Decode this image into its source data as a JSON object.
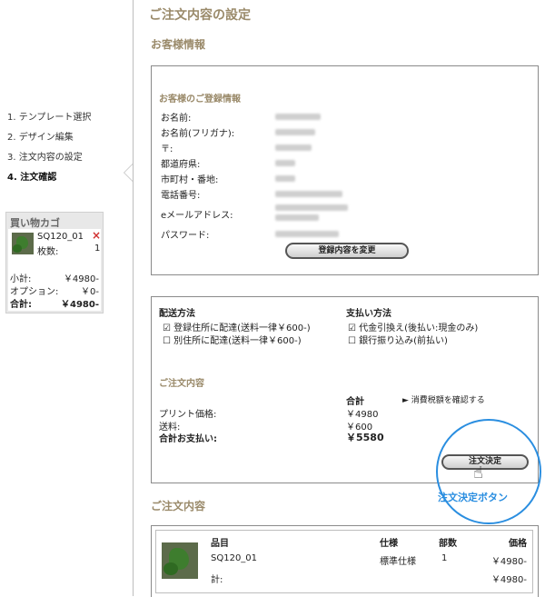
{
  "page": {
    "title": "ご注文内容の設定"
  },
  "steps": [
    {
      "label": "1. テンプレート選択"
    },
    {
      "label": "2. デザイン編集"
    },
    {
      "label": "3. 注文内容の設定"
    },
    {
      "label": "4. 注文確認"
    }
  ],
  "cart": {
    "title": "買い物カゴ",
    "item_name": "SQ120_01",
    "qty_label": "枚数:",
    "qty_value": "1",
    "remove_icon": "×",
    "subtotal_label": "小計:",
    "subtotal_value": "￥4980-",
    "option_label": "オプション:",
    "option_value": "￥0-",
    "total_label": "合計:",
    "total_value": "￥4980-"
  },
  "customer": {
    "section_title": "お客様情報",
    "registered_title": "お客様のご登録情報",
    "fields": [
      {
        "label": "お名前:"
      },
      {
        "label": "お名前(フリガナ):"
      },
      {
        "label": "〒:"
      },
      {
        "label": "都道府県:"
      },
      {
        "label": "市町村・番地:"
      },
      {
        "label": "電話番号:"
      },
      {
        "label": "eメールアドレス:"
      },
      {
        "label": "パスワード:"
      }
    ],
    "change_button": "登録内容を変更"
  },
  "shipping": {
    "title": "配送方法",
    "options": [
      {
        "label": "登録住所に配達(送料一律￥600-)",
        "mark": "☑"
      },
      {
        "label": "別住所に配達(送料一律￥600-)",
        "mark": "☐"
      }
    ]
  },
  "payment": {
    "title": "支払い方法",
    "options": [
      {
        "label": "代金引換え(後払い:現金のみ)",
        "mark": "☑"
      },
      {
        "label": "銀行振り込み(前払い)",
        "mark": "☐"
      }
    ]
  },
  "order_summary": {
    "title": "ご注文内容",
    "total_header": "合計",
    "tax_link": "消費税額を確認する",
    "rows": [
      {
        "label": "プリント価格:",
        "value": "￥4980"
      },
      {
        "label": "送料:",
        "value": "￥600"
      },
      {
        "label": "合計お支払い:",
        "value": "￥5580"
      }
    ],
    "confirm_button": "注文決定",
    "callout": "注文決定ボタン"
  },
  "order_table": {
    "section_title": "ご注文内容",
    "headers": {
      "item": "品目",
      "spec": "仕様",
      "qty": "部数",
      "price": "価格"
    },
    "row": {
      "item": "SQ120_01",
      "spec": "標準仕様",
      "qty": "1",
      "price": "￥4980-"
    },
    "total_label": "計:",
    "total_value": "￥4980-"
  }
}
